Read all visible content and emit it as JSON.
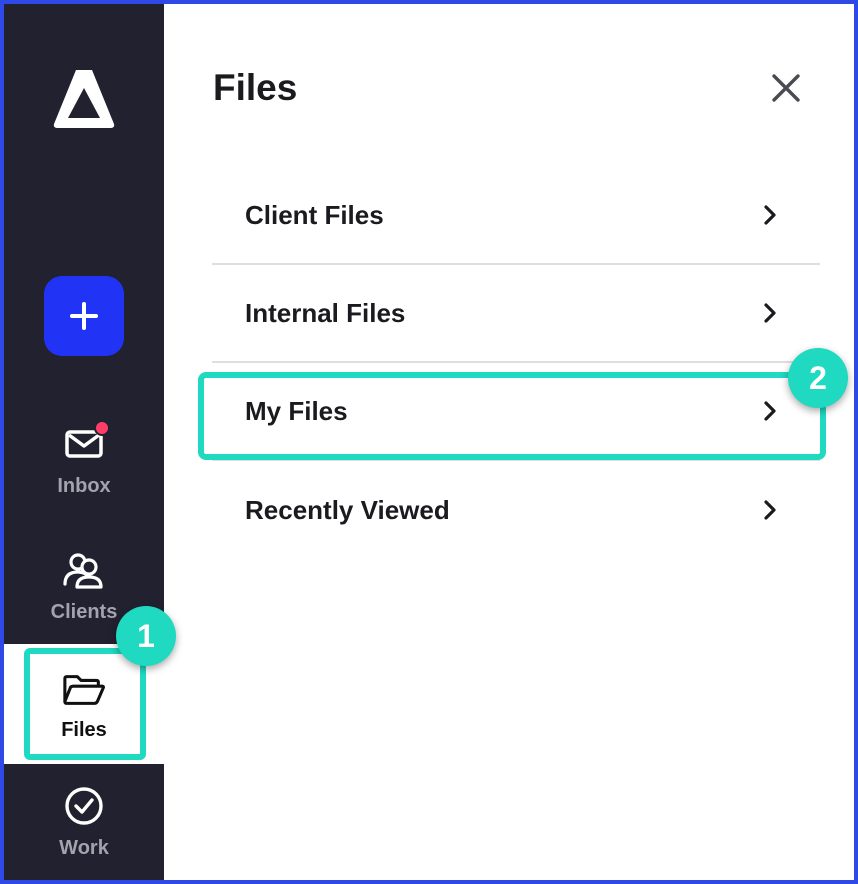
{
  "sidebar": {
    "logo_icon": "app-logo-icon",
    "add_icon": "plus-icon",
    "items": [
      {
        "label": "Inbox",
        "icon": "mail-icon",
        "has_notification": true
      },
      {
        "label": "Clients",
        "icon": "users-icon"
      },
      {
        "label": "Files",
        "icon": "folder-open-icon",
        "active": true
      },
      {
        "label": "Work",
        "icon": "check-circle-icon"
      }
    ]
  },
  "panel": {
    "title": "Files",
    "close_icon": "close-icon",
    "rows": [
      {
        "label": "Client Files"
      },
      {
        "label": "Internal Files"
      },
      {
        "label": "My Files"
      },
      {
        "label": "Recently Viewed"
      }
    ]
  },
  "tutorial": {
    "step_1": "1",
    "step_2": "2"
  },
  "colors": {
    "sidebar_bg": "#222130",
    "accent_blue": "#2133f5",
    "highlight_teal": "#1fd9c1",
    "notification_red": "#ff3d68",
    "border_blue": "#2f49e6"
  }
}
